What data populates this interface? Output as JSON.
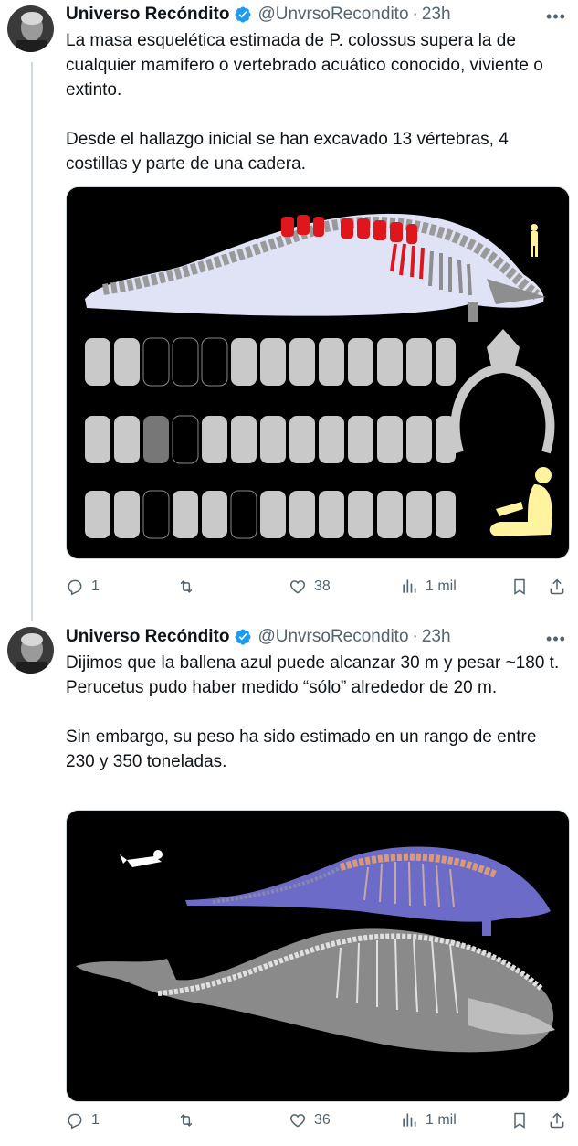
{
  "tweets": [
    {
      "author": {
        "name": "Universo Recóndito",
        "handle": "@UnvrsoRecondito",
        "time": "23h"
      },
      "text": [
        "La masa esquelética estimada de P. colossus supera la de cualquier mamífero o vertebrado acuático conocido, viviente o extinto.",
        "",
        "Desde el hallazgo inicial se han excavado 13 vértebras, 4 costillas y parte de una cadera."
      ],
      "actions": {
        "replies": "1",
        "reposts": "",
        "likes": "38",
        "views": "1 mil"
      }
    },
    {
      "author": {
        "name": "Universo Recóndito",
        "handle": "@UnvrsoRecondito",
        "time": "23h"
      },
      "text": [
        "Dijimos que la ballena azul puede alcanzar 30 m y pesar ~180 t.",
        "Perucetus pudo haber medido “sólo” alrededor de 20 m.",
        "",
        "Sin embargo, su peso ha sido estimado en un rango de entre 230 y 350 toneladas."
      ],
      "actions": {
        "replies": "1",
        "reposts": "",
        "likes": "36",
        "views": "1 mil"
      }
    }
  ],
  "colors": {
    "text": "#0f1419",
    "secondary": "#536471",
    "verified": "#1d9bf0",
    "border": "#cfd9de",
    "bone_red": "#e0161d",
    "human_yellow": "#fff3a0"
  },
  "icons": [
    "reply-icon",
    "repost-icon",
    "like-icon",
    "views-icon",
    "bookmark-icon",
    "share-icon",
    "more-icon",
    "verified-badge-icon"
  ]
}
